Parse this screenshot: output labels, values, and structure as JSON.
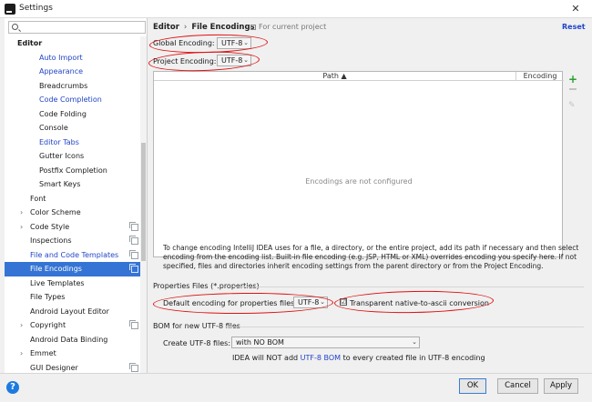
{
  "window": {
    "title": "Settings",
    "close": "✕"
  },
  "search": {
    "value": "",
    "placeholder": ""
  },
  "tree": [
    {
      "label": "Editor",
      "indent": 0,
      "bold": true
    },
    {
      "label": "Auto Import",
      "indent": 2,
      "link": true
    },
    {
      "label": "Appearance",
      "indent": 2,
      "link": true
    },
    {
      "label": "Breadcrumbs",
      "indent": 2
    },
    {
      "label": "Code Completion",
      "indent": 2,
      "link": true
    },
    {
      "label": "Code Folding",
      "indent": 2
    },
    {
      "label": "Console",
      "indent": 2
    },
    {
      "label": "Editor Tabs",
      "indent": 2,
      "link": true
    },
    {
      "label": "Gutter Icons",
      "indent": 2
    },
    {
      "label": "Postfix Completion",
      "indent": 2
    },
    {
      "label": "Smart Keys",
      "indent": 2
    },
    {
      "label": "Font",
      "indent": 1
    },
    {
      "label": "Color Scheme",
      "indent": 1,
      "expandable": true
    },
    {
      "label": "Code Style",
      "indent": 1,
      "expandable": true,
      "copy": true
    },
    {
      "label": "Inspections",
      "indent": 1,
      "copy": true
    },
    {
      "label": "File and Code Templates",
      "indent": 1,
      "link": true,
      "copy": true
    },
    {
      "label": "File Encodings",
      "indent": 1,
      "selected": true,
      "copy": true
    },
    {
      "label": "Live Templates",
      "indent": 1
    },
    {
      "label": "File Types",
      "indent": 1
    },
    {
      "label": "Android Layout Editor",
      "indent": 1
    },
    {
      "label": "Copyright",
      "indent": 1,
      "expandable": true,
      "copy": true
    },
    {
      "label": "Android Data Binding",
      "indent": 1
    },
    {
      "label": "Emmet",
      "indent": 1,
      "expandable": true
    },
    {
      "label": "GUI Designer",
      "indent": 1,
      "copy": true
    }
  ],
  "breadcrumb": {
    "parent": "Editor",
    "separator": "›",
    "current": "File Encodings",
    "note": "For current project"
  },
  "reset": "Reset",
  "global_encoding": {
    "label": "Global Encoding:",
    "value": "UTF-8"
  },
  "project_encoding": {
    "label": "Project Encoding:",
    "value": "UTF-8"
  },
  "table": {
    "col_path": "Path ▲",
    "col_encoding": "Encoding",
    "empty": "Encodings are not configured"
  },
  "help_text": "To change encoding IntelliJ IDEA uses for a file, a directory, or the entire project, add its path if necessary and then select encoding from the encoding list. Built-in file encoding (e.g. JSP, HTML or XML) overrides encoding you specify here. If not specified, files and directories inherit encoding settings from the parent directory or from the Project Encoding.",
  "properties": {
    "title": "Properties Files (*.properties)",
    "default_label": "Default encoding for properties files:",
    "default_value": "UTF-8",
    "native_label": "Transparent native-to-ascii conversion",
    "native_checked": "☑"
  },
  "bom": {
    "title": "BOM for new UTF-8 files",
    "create_label": "Create UTF-8 files:",
    "create_value": "with NO BOM",
    "info_pre": "IDEA will NOT add",
    "info_link": "UTF-8 BOM",
    "info_post": "to every created file in UTF-8 encoding"
  },
  "buttons": {
    "help": "?",
    "ok": "OK",
    "cancel": "Cancel",
    "apply": "Apply"
  },
  "colors": {
    "selection": "#3574d4",
    "link": "#2145c8",
    "annotation": "#e01010",
    "add": "#2aa02a"
  }
}
